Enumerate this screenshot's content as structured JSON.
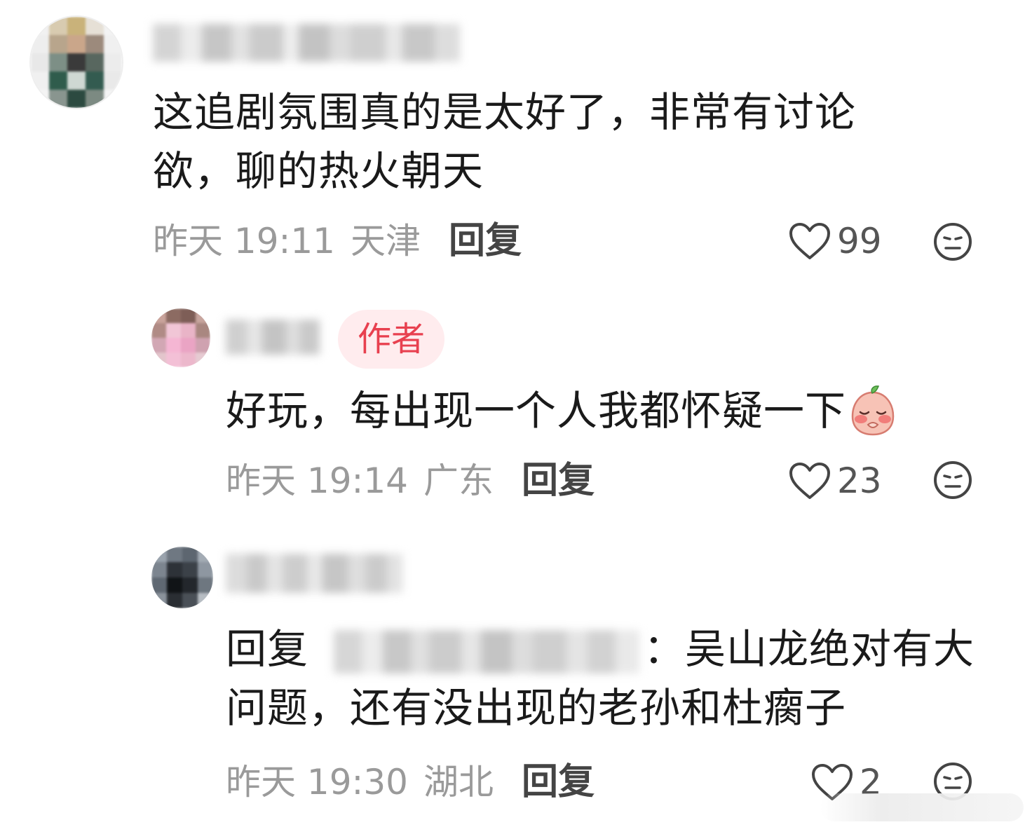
{
  "comments": [
    {
      "text": "这追剧氛围真的是太好了，非常有讨论欲，聊的热火朝天",
      "time": "昨天 19:11",
      "location": "天津",
      "reply_label": "回复",
      "likes": "99",
      "avatar_icon": "user-avatar-blurred",
      "dislike_icon": "meh-face-icon"
    },
    {
      "badge": "作者",
      "text": "好玩，每出现一个人我都怀疑一下",
      "emoji_icon": "peach-shy-emoji-icon",
      "time": "昨天 19:14",
      "location": "广东",
      "reply_label": "回复",
      "likes": "23",
      "avatar_icon": "user-avatar-blurred",
      "dislike_icon": "meh-face-icon"
    },
    {
      "reply_prefix": "回复",
      "reply_separator": "：",
      "text": "吴山龙绝对有大问题，还有没出现的老孙和杜瘸子",
      "time": "昨天 19:30",
      "location": "湖北",
      "reply_label": "回复",
      "likes": "2",
      "avatar_icon": "user-avatar-blurred",
      "dislike_icon": "meh-face-icon"
    }
  ],
  "colors": {
    "badge_text": "#e8404f",
    "badge_bg": "#ffecee",
    "meta_text": "#9a9a9a"
  }
}
